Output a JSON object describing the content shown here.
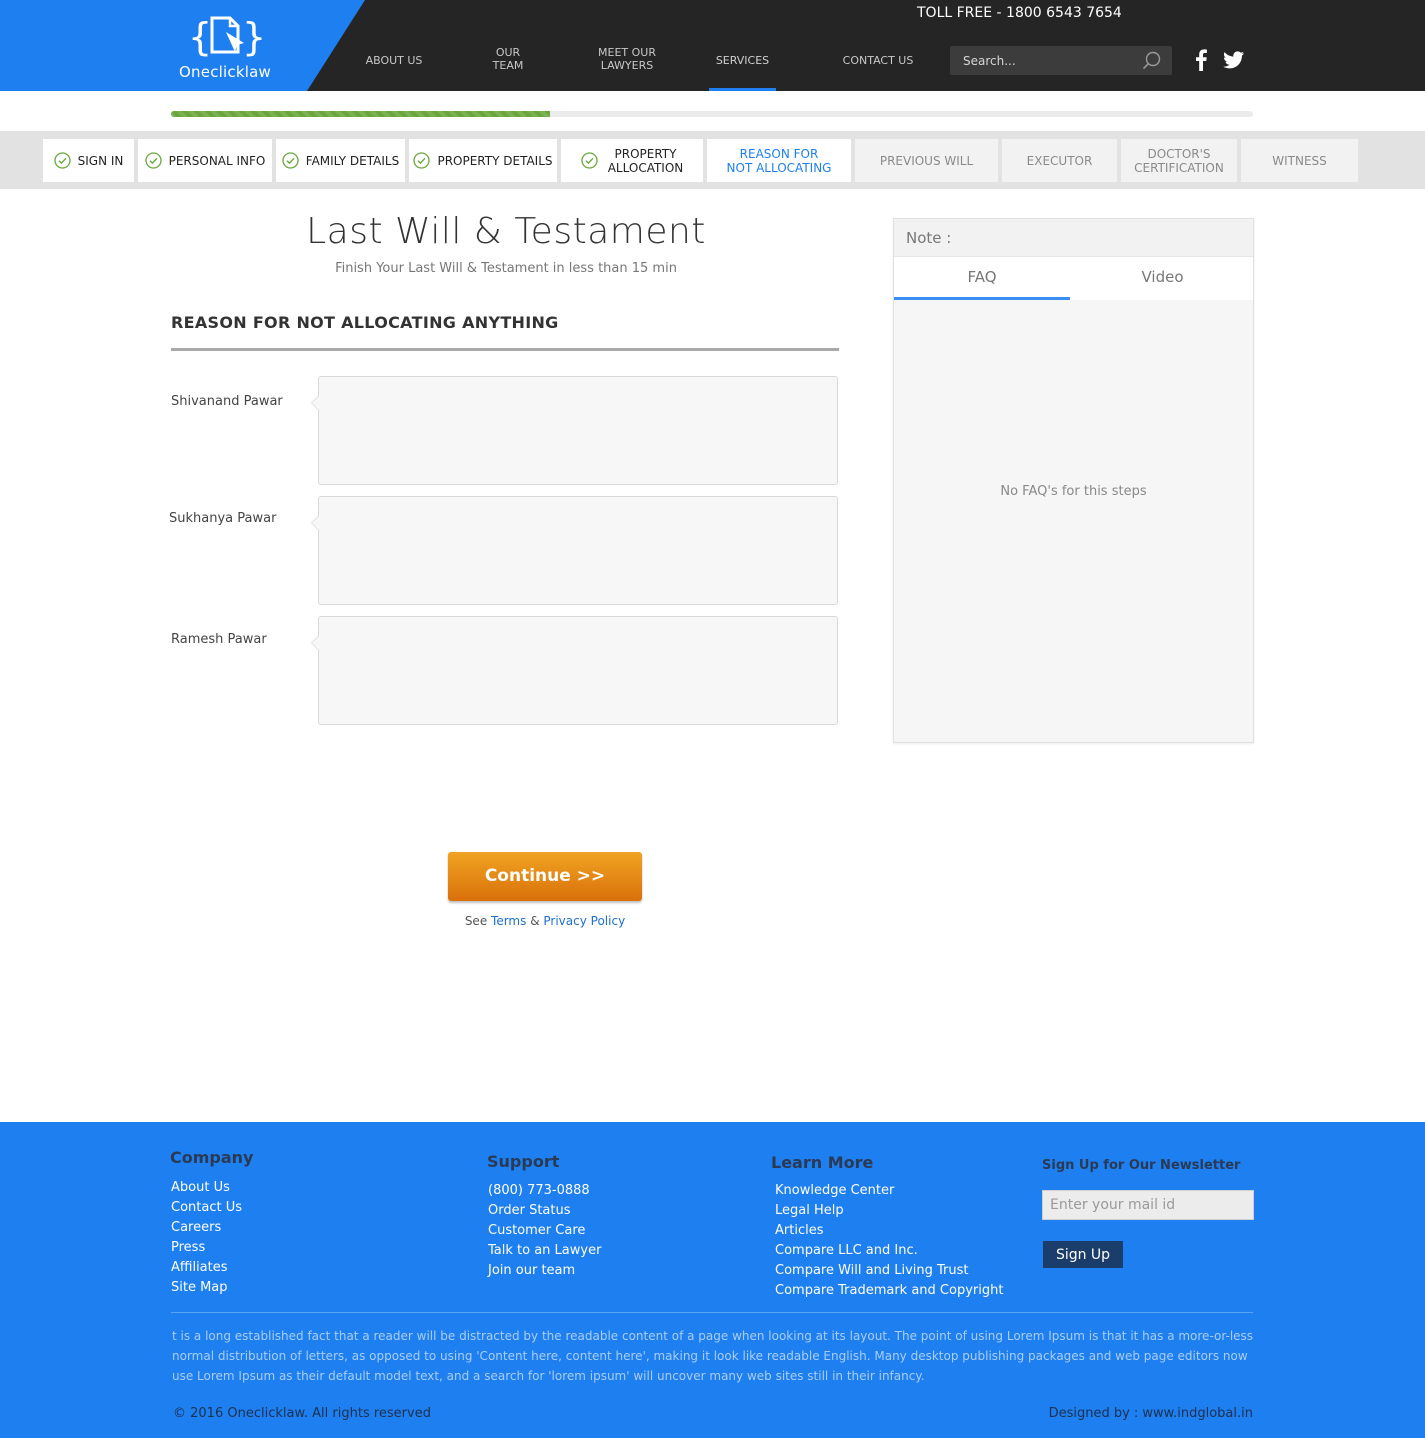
{
  "header": {
    "brand": "Oneclicklaw",
    "toll_free": "TOLL FREE - 1800 6543 7654",
    "nav": [
      {
        "label": "ABOUT US"
      },
      {
        "label": "OUR\nTEAM"
      },
      {
        "label": "MEET OUR\nLAWYERS"
      },
      {
        "label": "SERVICES"
      },
      {
        "label": "CONTACT US"
      }
    ],
    "search_placeholder": "Search...",
    "icons": [
      "search-icon",
      "facebook-icon",
      "twitter-icon"
    ],
    "accent_color": "#1e7ff0"
  },
  "progress": {
    "value_percent": 35
  },
  "steps": [
    {
      "label": "SIGN IN",
      "state": "done"
    },
    {
      "label": "PERSONAL INFO",
      "state": "done"
    },
    {
      "label": "FAMILY DETAILS",
      "state": "done"
    },
    {
      "label": "PROPERTY DETAILS",
      "state": "done"
    },
    {
      "label": "PROPERTY\nALLOCATION",
      "state": "done"
    },
    {
      "label": "REASON FOR\nNOT ALLOCATING",
      "state": "current"
    },
    {
      "label": "PREVIOUS WILL",
      "state": "todo"
    },
    {
      "label": "EXECUTOR",
      "state": "todo"
    },
    {
      "label": "DOCTOR'S\nCERTIFICATION",
      "state": "todo"
    },
    {
      "label": "WITNESS",
      "state": "todo"
    }
  ],
  "main": {
    "title": "Last Will & Testament",
    "subtitle": "Finish Your Last Will & Testament in less than 15 min",
    "section_title": "REASON FOR NOT ALLOCATING ANYTHING",
    "people": [
      {
        "name": "Shivanand Pawar",
        "reason": ""
      },
      {
        "name": "Sukhanya Pawar",
        "reason": ""
      },
      {
        "name": "Ramesh Pawar",
        "reason": ""
      }
    ],
    "continue_label": "Continue >>",
    "terms_prefix": "See",
    "terms_link": "Terms",
    "terms_and": "&",
    "privacy_link": "Privacy Policy"
  },
  "note": {
    "title": "Note :",
    "tabs": [
      "FAQ",
      "Video"
    ],
    "active_tab": "FAQ",
    "empty_text": "No FAQ's for this steps"
  },
  "footer": {
    "company": {
      "heading": "Company",
      "links": [
        "About Us",
        "Contact Us",
        "Careers",
        "Press",
        "Affiliates",
        "Site Map"
      ]
    },
    "support": {
      "heading": "Support",
      "links": [
        "(800) 773-0888",
        "Order Status",
        "Customer Care",
        "Talk to an Lawyer",
        "Join our team"
      ]
    },
    "learn": {
      "heading": "Learn More",
      "links": [
        "Knowledge Center",
        "Legal Help",
        "Articles",
        "Compare LLC and Inc.",
        "Compare Will and Living Trust",
        "Compare Trademark and Copyright"
      ]
    },
    "newsletter": {
      "heading": "Sign Up for Our Newsletter",
      "placeholder": "Enter your mail id",
      "button": "Sign Up"
    },
    "lorem": "t is a long established fact that a reader will be distracted by the readable content of a page when looking at its layout. The point of using Lorem Ipsum is that it has a more-or-less normal distribution of letters, as opposed to using 'Content here, content here', making it look like readable English. Many desktop publishing packages and web page editors now use Lorem Ipsum as their default model text, and a search for 'lorem ipsum' will uncover many web sites still in their infancy.",
    "copyright": "© 2016 Oneclicklaw. All rights reserved",
    "designed_by": "Designed by : www.indglobal.in"
  }
}
